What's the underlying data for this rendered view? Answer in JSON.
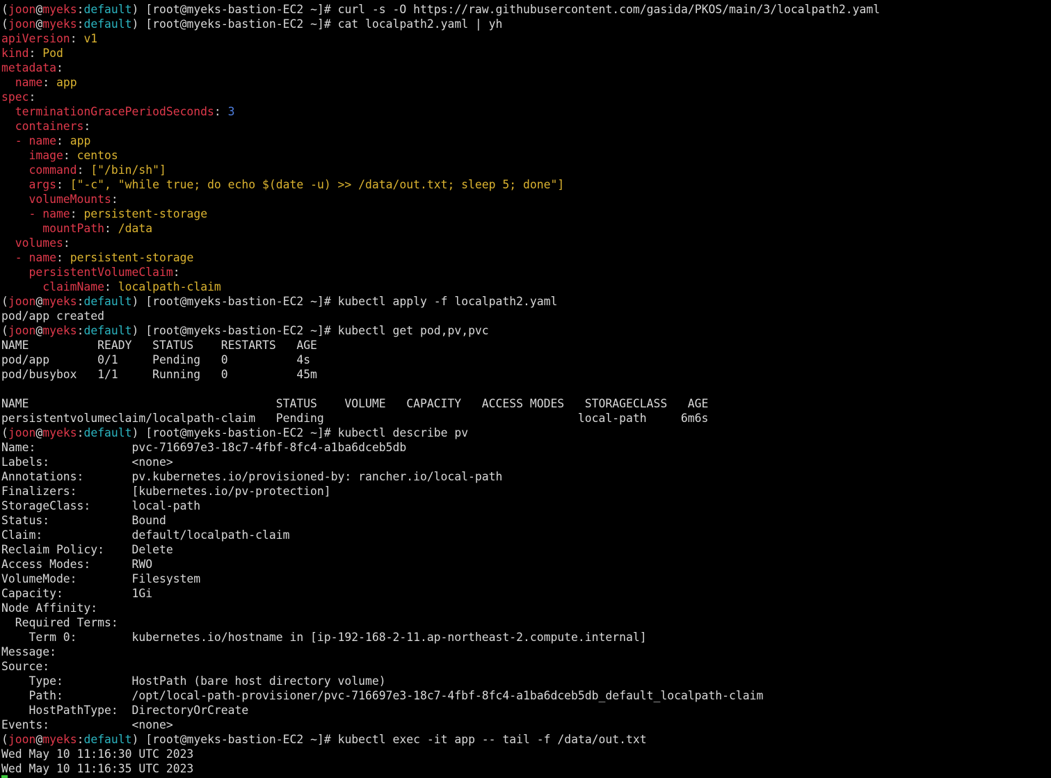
{
  "terminal": {
    "colors": {
      "background": "#000000",
      "default": "#d9d9d9",
      "red": "#e0394b",
      "teal": "#2bb5c1",
      "yellow": "#dcb430",
      "blue": "#4f7fe0",
      "cursor": "#3cc83c"
    },
    "lines": [
      {
        "kind": "prompt",
        "segments": [
          {
            "t": "(",
            "c": "white"
          },
          {
            "t": "joon",
            "c": "red"
          },
          {
            "t": "@",
            "c": "white"
          },
          {
            "t": "myeks",
            "c": "red"
          },
          {
            "t": ":",
            "c": "white"
          },
          {
            "t": "default",
            "c": "teal"
          },
          {
            "t": ") [root@myeks-bastion-EC2 ~]# curl -s -O https://raw.githubusercontent.com/gasida/PKOS/main/3/localpath2.yaml",
            "c": "white"
          }
        ]
      },
      {
        "kind": "prompt",
        "segments": [
          {
            "t": "(",
            "c": "white"
          },
          {
            "t": "joon",
            "c": "red"
          },
          {
            "t": "@",
            "c": "white"
          },
          {
            "t": "myeks",
            "c": "red"
          },
          {
            "t": ":",
            "c": "white"
          },
          {
            "t": "default",
            "c": "teal"
          },
          {
            "t": ") [root@myeks-bastion-EC2 ~]# cat localpath2.yaml | yh",
            "c": "white"
          }
        ]
      },
      {
        "kind": "yaml",
        "segments": [
          {
            "t": "apiVersion",
            "c": "red"
          },
          {
            "t": ": ",
            "c": "white"
          },
          {
            "t": "v1",
            "c": "yellow"
          }
        ]
      },
      {
        "kind": "yaml",
        "segments": [
          {
            "t": "kind",
            "c": "red"
          },
          {
            "t": ": ",
            "c": "white"
          },
          {
            "t": "Pod",
            "c": "yellow"
          }
        ]
      },
      {
        "kind": "yaml",
        "segments": [
          {
            "t": "metadata",
            "c": "red"
          },
          {
            "t": ":",
            "c": "white"
          }
        ]
      },
      {
        "kind": "yaml",
        "segments": [
          {
            "t": "  name",
            "c": "red"
          },
          {
            "t": ": ",
            "c": "white"
          },
          {
            "t": "app",
            "c": "yellow"
          }
        ]
      },
      {
        "kind": "yaml",
        "segments": [
          {
            "t": "spec",
            "c": "red"
          },
          {
            "t": ":",
            "c": "white"
          }
        ]
      },
      {
        "kind": "yaml",
        "segments": [
          {
            "t": "  terminationGracePeriodSeconds",
            "c": "red"
          },
          {
            "t": ": ",
            "c": "white"
          },
          {
            "t": "3",
            "c": "blue"
          }
        ]
      },
      {
        "kind": "yaml",
        "segments": [
          {
            "t": "  containers",
            "c": "red"
          },
          {
            "t": ":",
            "c": "white"
          }
        ]
      },
      {
        "kind": "yaml",
        "segments": [
          {
            "t": "  - name",
            "c": "red"
          },
          {
            "t": ": ",
            "c": "white"
          },
          {
            "t": "app",
            "c": "yellow"
          }
        ]
      },
      {
        "kind": "yaml",
        "segments": [
          {
            "t": "    image",
            "c": "red"
          },
          {
            "t": ": ",
            "c": "white"
          },
          {
            "t": "centos",
            "c": "yellow"
          }
        ]
      },
      {
        "kind": "yaml",
        "segments": [
          {
            "t": "    command",
            "c": "red"
          },
          {
            "t": ": ",
            "c": "white"
          },
          {
            "t": "[\"/bin/sh\"]",
            "c": "yellow"
          }
        ]
      },
      {
        "kind": "yaml",
        "segments": [
          {
            "t": "    args",
            "c": "red"
          },
          {
            "t": ": ",
            "c": "white"
          },
          {
            "t": "[\"-c\", \"while true; do echo $(date -u) >> /data/out.txt; sleep 5; done\"]",
            "c": "yellow"
          }
        ]
      },
      {
        "kind": "yaml",
        "segments": [
          {
            "t": "    volumeMounts",
            "c": "red"
          },
          {
            "t": ":",
            "c": "white"
          }
        ]
      },
      {
        "kind": "yaml",
        "segments": [
          {
            "t": "    - name",
            "c": "red"
          },
          {
            "t": ": ",
            "c": "white"
          },
          {
            "t": "persistent-storage",
            "c": "yellow"
          }
        ]
      },
      {
        "kind": "yaml",
        "segments": [
          {
            "t": "      mountPath",
            "c": "red"
          },
          {
            "t": ": ",
            "c": "white"
          },
          {
            "t": "/data",
            "c": "yellow"
          }
        ]
      },
      {
        "kind": "yaml",
        "segments": [
          {
            "t": "  volumes",
            "c": "red"
          },
          {
            "t": ":",
            "c": "white"
          }
        ]
      },
      {
        "kind": "yaml",
        "segments": [
          {
            "t": "  - name",
            "c": "red"
          },
          {
            "t": ": ",
            "c": "white"
          },
          {
            "t": "persistent-storage",
            "c": "yellow"
          }
        ]
      },
      {
        "kind": "yaml",
        "segments": [
          {
            "t": "    persistentVolumeClaim",
            "c": "red"
          },
          {
            "t": ":",
            "c": "white"
          }
        ]
      },
      {
        "kind": "yaml",
        "segments": [
          {
            "t": "      claimName",
            "c": "red"
          },
          {
            "t": ": ",
            "c": "white"
          },
          {
            "t": "localpath-claim",
            "c": "yellow"
          }
        ]
      },
      {
        "kind": "prompt",
        "segments": [
          {
            "t": "(",
            "c": "white"
          },
          {
            "t": "joon",
            "c": "red"
          },
          {
            "t": "@",
            "c": "white"
          },
          {
            "t": "myeks",
            "c": "red"
          },
          {
            "t": ":",
            "c": "white"
          },
          {
            "t": "default",
            "c": "teal"
          },
          {
            "t": ") [root@myeks-bastion-EC2 ~]# kubectl apply -f localpath2.yaml",
            "c": "white"
          }
        ]
      },
      {
        "kind": "output",
        "segments": [
          {
            "t": "pod/app created",
            "c": "white"
          }
        ]
      },
      {
        "kind": "prompt",
        "segments": [
          {
            "t": "(",
            "c": "white"
          },
          {
            "t": "joon",
            "c": "red"
          },
          {
            "t": "@",
            "c": "white"
          },
          {
            "t": "myeks",
            "c": "red"
          },
          {
            "t": ":",
            "c": "white"
          },
          {
            "t": "default",
            "c": "teal"
          },
          {
            "t": ") [root@myeks-bastion-EC2 ~]# kubectl get pod,pv,pvc",
            "c": "white"
          }
        ]
      },
      {
        "kind": "output",
        "segments": [
          {
            "t": "NAME          READY   STATUS    RESTARTS   AGE",
            "c": "white"
          }
        ]
      },
      {
        "kind": "output",
        "segments": [
          {
            "t": "pod/app       0/1     Pending   0          4s",
            "c": "white"
          }
        ]
      },
      {
        "kind": "output",
        "segments": [
          {
            "t": "pod/busybox   1/1     Running   0          45m",
            "c": "white"
          }
        ]
      },
      {
        "kind": "output",
        "segments": [
          {
            "t": "",
            "c": "white"
          }
        ]
      },
      {
        "kind": "output",
        "segments": [
          {
            "t": "NAME                                    STATUS    VOLUME   CAPACITY   ACCESS MODES   STORAGECLASS   AGE",
            "c": "white"
          }
        ]
      },
      {
        "kind": "output",
        "segments": [
          {
            "t": "persistentvolumeclaim/localpath-claim   Pending                                     local-path     6m6s",
            "c": "white"
          }
        ]
      },
      {
        "kind": "prompt",
        "segments": [
          {
            "t": "(",
            "c": "white"
          },
          {
            "t": "joon",
            "c": "red"
          },
          {
            "t": "@",
            "c": "white"
          },
          {
            "t": "myeks",
            "c": "red"
          },
          {
            "t": ":",
            "c": "white"
          },
          {
            "t": "default",
            "c": "teal"
          },
          {
            "t": ") [root@myeks-bastion-EC2 ~]# kubectl describe pv",
            "c": "white"
          }
        ]
      },
      {
        "kind": "output",
        "segments": [
          {
            "t": "Name:              pvc-716697e3-18c7-4fbf-8fc4-a1ba6dceb5db",
            "c": "white"
          }
        ]
      },
      {
        "kind": "output",
        "segments": [
          {
            "t": "Labels:            <none>",
            "c": "white"
          }
        ]
      },
      {
        "kind": "output",
        "segments": [
          {
            "t": "Annotations:       pv.kubernetes.io/provisioned-by: rancher.io/local-path",
            "c": "white"
          }
        ]
      },
      {
        "kind": "output",
        "segments": [
          {
            "t": "Finalizers:        [kubernetes.io/pv-protection]",
            "c": "white"
          }
        ]
      },
      {
        "kind": "output",
        "segments": [
          {
            "t": "StorageClass:      local-path",
            "c": "white"
          }
        ]
      },
      {
        "kind": "output",
        "segments": [
          {
            "t": "Status:            Bound",
            "c": "white"
          }
        ]
      },
      {
        "kind": "output",
        "segments": [
          {
            "t": "Claim:             default/localpath-claim",
            "c": "white"
          }
        ]
      },
      {
        "kind": "output",
        "segments": [
          {
            "t": "Reclaim Policy:    Delete",
            "c": "white"
          }
        ]
      },
      {
        "kind": "output",
        "segments": [
          {
            "t": "Access Modes:      RWO",
            "c": "white"
          }
        ]
      },
      {
        "kind": "output",
        "segments": [
          {
            "t": "VolumeMode:        Filesystem",
            "c": "white"
          }
        ]
      },
      {
        "kind": "output",
        "segments": [
          {
            "t": "Capacity:          1Gi",
            "c": "white"
          }
        ]
      },
      {
        "kind": "output",
        "segments": [
          {
            "t": "Node Affinity:",
            "c": "white"
          }
        ]
      },
      {
        "kind": "output",
        "segments": [
          {
            "t": "  Required Terms:",
            "c": "white"
          }
        ]
      },
      {
        "kind": "output",
        "segments": [
          {
            "t": "    Term 0:        kubernetes.io/hostname in [ip-192-168-2-11.ap-northeast-2.compute.internal]",
            "c": "white"
          }
        ]
      },
      {
        "kind": "output",
        "segments": [
          {
            "t": "Message:",
            "c": "white"
          }
        ]
      },
      {
        "kind": "output",
        "segments": [
          {
            "t": "Source:",
            "c": "white"
          }
        ]
      },
      {
        "kind": "output",
        "segments": [
          {
            "t": "    Type:          HostPath (bare host directory volume)",
            "c": "white"
          }
        ]
      },
      {
        "kind": "output",
        "segments": [
          {
            "t": "    Path:          /opt/local-path-provisioner/pvc-716697e3-18c7-4fbf-8fc4-a1ba6dceb5db_default_localpath-claim",
            "c": "white"
          }
        ]
      },
      {
        "kind": "output",
        "segments": [
          {
            "t": "    HostPathType:  DirectoryOrCreate",
            "c": "white"
          }
        ]
      },
      {
        "kind": "output",
        "segments": [
          {
            "t": "Events:            <none>",
            "c": "white"
          }
        ]
      },
      {
        "kind": "prompt",
        "segments": [
          {
            "t": "(",
            "c": "white"
          },
          {
            "t": "joon",
            "c": "red"
          },
          {
            "t": "@",
            "c": "white"
          },
          {
            "t": "myeks",
            "c": "red"
          },
          {
            "t": ":",
            "c": "white"
          },
          {
            "t": "default",
            "c": "teal"
          },
          {
            "t": ") [root@myeks-bastion-EC2 ~]# kubectl exec -it app -- tail -f /data/out.txt",
            "c": "white"
          }
        ]
      },
      {
        "kind": "output",
        "segments": [
          {
            "t": "Wed May 10 11:16:30 UTC 2023",
            "c": "white"
          }
        ]
      },
      {
        "kind": "output",
        "segments": [
          {
            "t": "Wed May 10 11:16:35 UTC 2023",
            "c": "white"
          }
        ]
      }
    ]
  }
}
